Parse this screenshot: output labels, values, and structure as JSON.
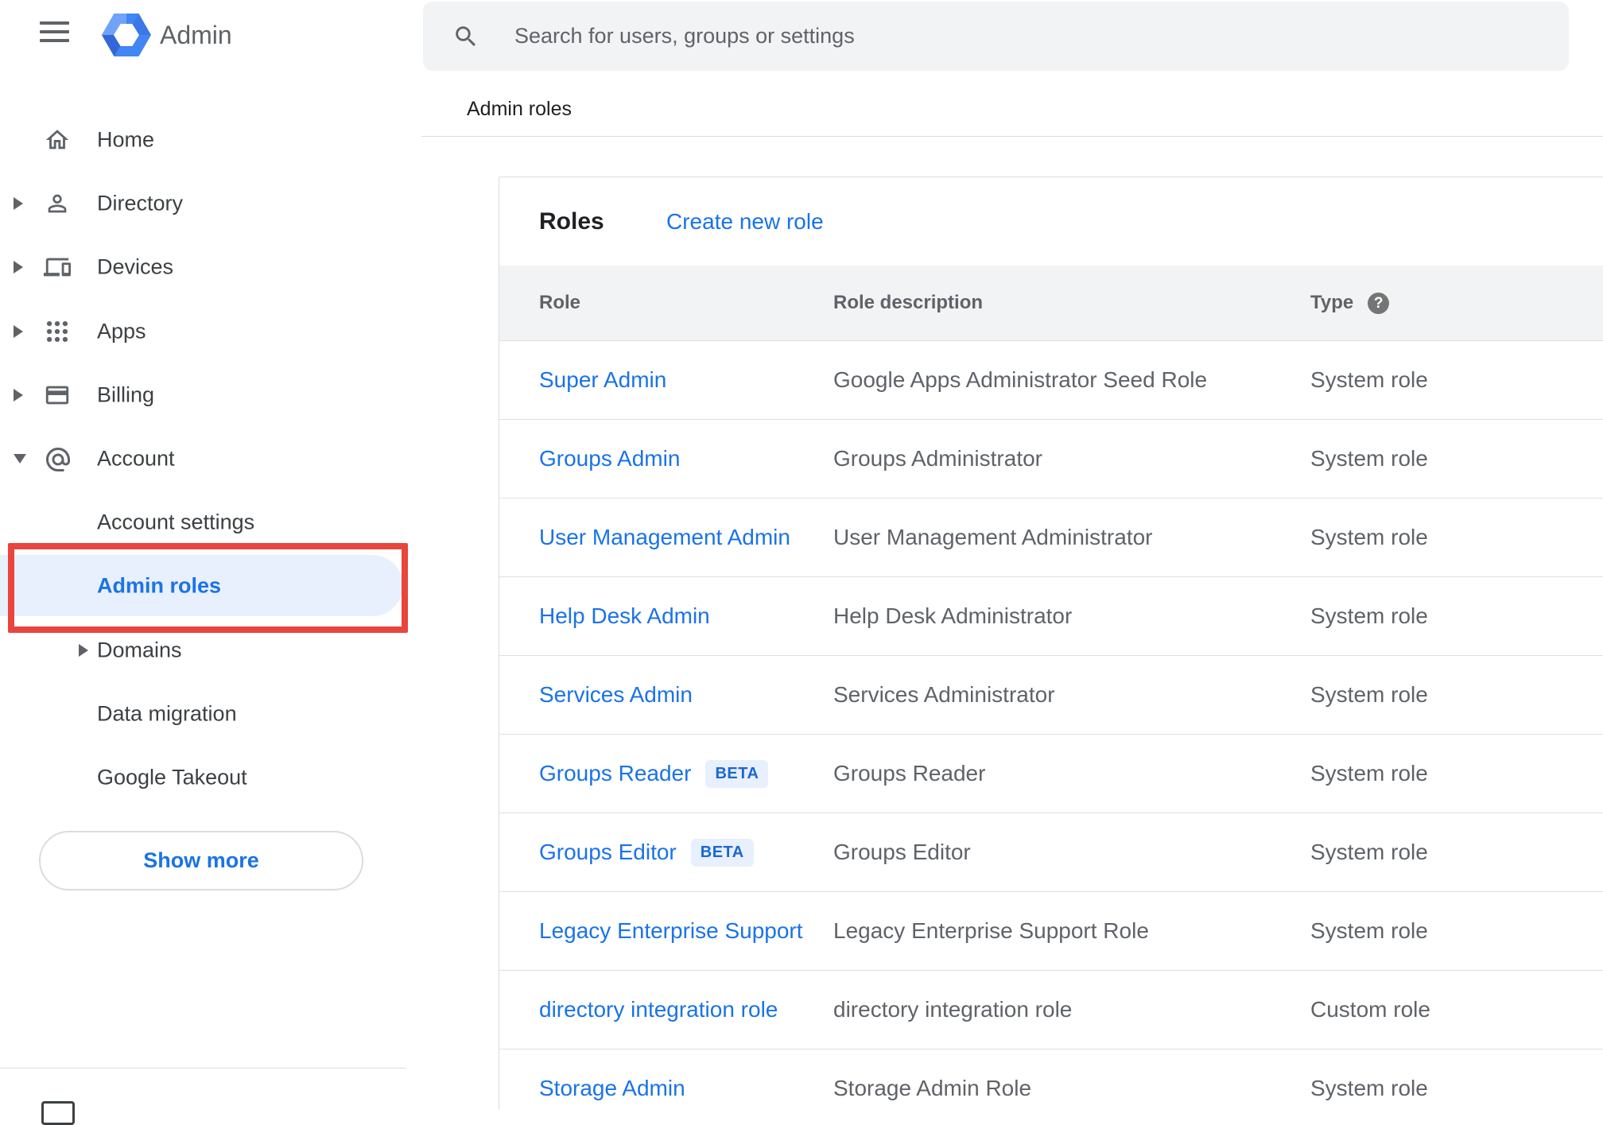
{
  "topbar": {
    "app_title": "Admin",
    "search_placeholder": "Search for users, groups or settings"
  },
  "breadcrumb": {
    "label": "Admin roles"
  },
  "sidebar": {
    "items": [
      {
        "label": "Home",
        "icon": "home-icon",
        "level": "main",
        "arrow": "none"
      },
      {
        "label": "Directory",
        "icon": "directory-icon",
        "level": "main",
        "arrow": "collapsed"
      },
      {
        "label": "Devices",
        "icon": "devices-icon",
        "level": "main",
        "arrow": "collapsed"
      },
      {
        "label": "Apps",
        "icon": "apps-icon",
        "level": "main",
        "arrow": "collapsed"
      },
      {
        "label": "Billing",
        "icon": "billing-icon",
        "level": "main",
        "arrow": "collapsed"
      },
      {
        "label": "Account",
        "icon": "account-icon",
        "level": "main",
        "arrow": "expanded"
      },
      {
        "label": "Account settings",
        "icon": null,
        "level": "sub",
        "arrow": "none"
      },
      {
        "label": "Admin roles",
        "icon": null,
        "level": "sub",
        "arrow": "none",
        "active": true,
        "annotated": true
      },
      {
        "label": "Domains",
        "icon": null,
        "level": "sub",
        "arrow": "collapsed"
      },
      {
        "label": "Data migration",
        "icon": null,
        "level": "sub",
        "arrow": "none"
      },
      {
        "label": "Google Takeout",
        "icon": null,
        "level": "sub",
        "arrow": "none"
      }
    ],
    "show_more_label": "Show more"
  },
  "page": {
    "card_title": "Roles",
    "create_role_label": "Create new role",
    "columns": [
      "Role",
      "Role description",
      "Type"
    ],
    "beta_label": "BETA",
    "rows": [
      {
        "role": "Super Admin",
        "beta": false,
        "description": "Google Apps Administrator Seed Role",
        "type": "System role"
      },
      {
        "role": "Groups Admin",
        "beta": false,
        "description": "Groups Administrator",
        "type": "System role"
      },
      {
        "role": "User Management Admin",
        "beta": false,
        "description": "User Management Administrator",
        "type": "System role"
      },
      {
        "role": "Help Desk Admin",
        "beta": false,
        "description": "Help Desk Administrator",
        "type": "System role"
      },
      {
        "role": "Services Admin",
        "beta": false,
        "description": "Services Administrator",
        "type": "System role"
      },
      {
        "role": "Groups Reader",
        "beta": true,
        "description": "Groups Reader",
        "type": "System role"
      },
      {
        "role": "Groups Editor",
        "beta": true,
        "description": "Groups Editor",
        "type": "System role"
      },
      {
        "role": "Legacy Enterprise Support",
        "beta": false,
        "description": "Legacy Enterprise Support Role",
        "type": "System role"
      },
      {
        "role": "directory integration role",
        "beta": false,
        "description": "directory integration role",
        "type": "Custom role"
      },
      {
        "role": "Storage Admin",
        "beta": false,
        "description": "Storage Admin Role",
        "type": "System role"
      }
    ]
  },
  "colors": {
    "link_blue": "#1a73e8",
    "active_pill_bg": "#e8f0fe",
    "annotation_red": "#e8453c",
    "header_band_bg": "#f1f3f4",
    "icon_gray": "#5f6368",
    "logo_blue": "#4285f4"
  }
}
